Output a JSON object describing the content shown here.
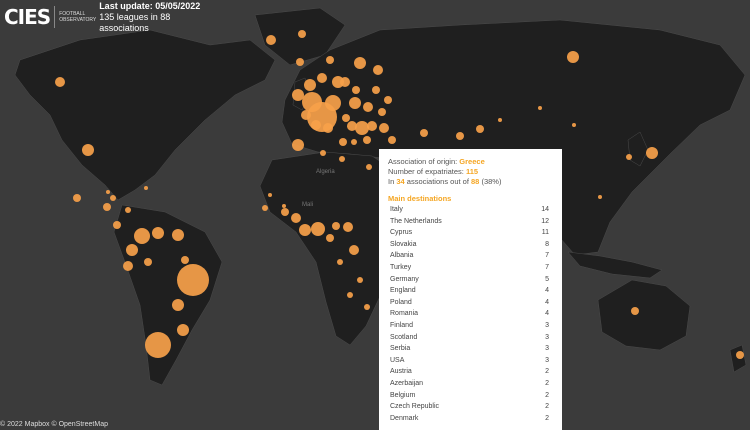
{
  "header": {
    "logo_text": "CIES",
    "logo_subtitle": "FOOTBALL OBSERVATORY",
    "last_update": "Last update: 05/05/2022",
    "coverage": "135 leagues  in 88 associations"
  },
  "credit": "© 2022 Mapbox © OpenStreetMap",
  "map_labels": {
    "algeria": "Algeria",
    "mali": "Mali"
  },
  "tooltip": {
    "origin_label": "Association of origin:",
    "origin_value": "Greece",
    "expat_label": "Number of expatriates:",
    "expat_value": "115",
    "in_prefix": "In",
    "in_count": "34",
    "in_middle": "associations out of",
    "in_total": "88",
    "in_pct": "(38%)",
    "section_title": "Main destinations",
    "destinations": [
      {
        "name": "Italy",
        "count": "14"
      },
      {
        "name": "The Netherlands",
        "count": "12"
      },
      {
        "name": "Cyprus",
        "count": "11"
      },
      {
        "name": "Slovakia",
        "count": "8"
      },
      {
        "name": "Albania",
        "count": "7"
      },
      {
        "name": "Turkey",
        "count": "7"
      },
      {
        "name": "Germany",
        "count": "5"
      },
      {
        "name": "England",
        "count": "4"
      },
      {
        "name": "Poland",
        "count": "4"
      },
      {
        "name": "Romania",
        "count": "4"
      },
      {
        "name": "Finland",
        "count": "3"
      },
      {
        "name": "Scotland",
        "count": "3"
      },
      {
        "name": "Serbia",
        "count": "3"
      },
      {
        "name": "USA",
        "count": "3"
      },
      {
        "name": "Austria",
        "count": "2"
      },
      {
        "name": "Azerbaijan",
        "count": "2"
      },
      {
        "name": "Belgium",
        "count": "2"
      },
      {
        "name": "Czech Republic",
        "count": "2"
      },
      {
        "name": "Denmark",
        "count": "2"
      }
    ]
  },
  "colors": {
    "ocean": "#3b3b3b",
    "land": "#1f1f1f",
    "bubble": "#f7a14a",
    "highlight": "#f5a623"
  }
}
